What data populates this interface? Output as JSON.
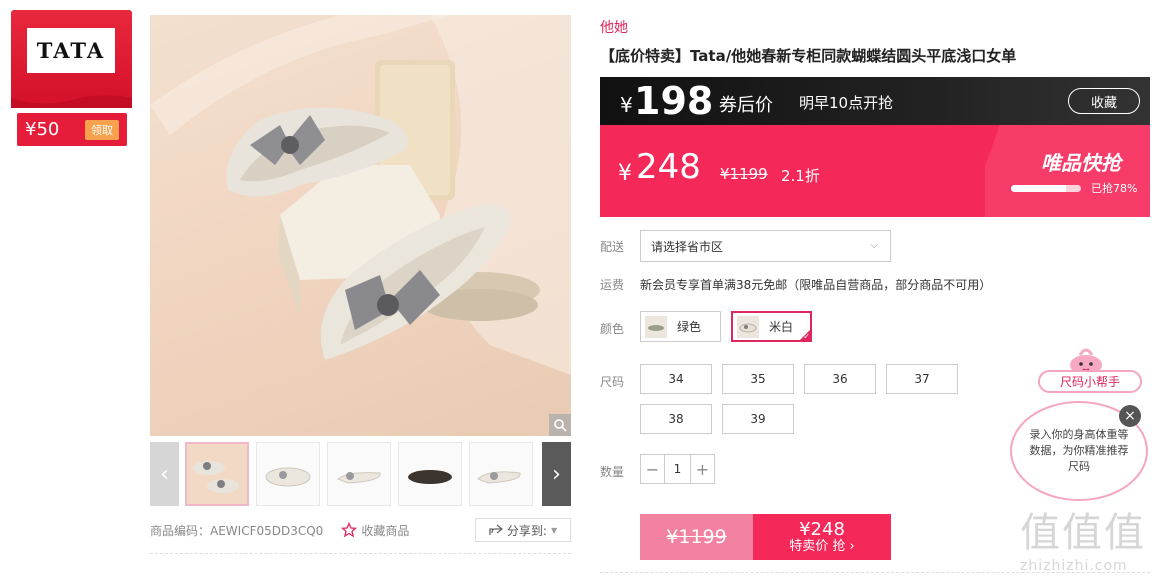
{
  "brand_badge": {
    "logo_text": "TATA",
    "coupon_value": "¥50",
    "coupon_action": "领取"
  },
  "gallery": {
    "thumbnails": [
      "thumb-1",
      "thumb-2",
      "thumb-3",
      "thumb-4",
      "thumb-5"
    ],
    "active_index": 0
  },
  "meta": {
    "sku_label": "商品编码：AEWICF05DD3CQ0",
    "favorite_label": "收藏商品",
    "share_label": "分享到:"
  },
  "product": {
    "brand": "他她",
    "title": "【底价特卖】Tata/他她春新专柜同款蝴蝶结圆头平底浅口女单"
  },
  "coupon_price": {
    "currency": "¥",
    "price": "198",
    "label": "券后价",
    "open_time": "明早10点开抢",
    "collect_label": "收藏"
  },
  "flash_price": {
    "currency": "¥",
    "price": "248",
    "original": "¥1199",
    "discount": "2.1折",
    "title": "唯品快抢",
    "sold_pct": 0.78,
    "sold_text": "已抢78%"
  },
  "attrs": {
    "delivery_label": "配送",
    "delivery_placeholder": "请选择省市区",
    "fee_label": "运费",
    "fee_text": "新会员专享首单满38元免邮（限唯品自营商品，部分商品不可用）",
    "color_label": "颜色",
    "colors": [
      "绿色",
      "米白"
    ],
    "selected_color": "米白",
    "size_label": "尺码",
    "sizes": [
      "34",
      "35",
      "36",
      "37",
      "38",
      "39"
    ],
    "qty_label": "数量",
    "qty_value": "1"
  },
  "buy": {
    "original": "¥1199",
    "price": "¥248",
    "action": "特卖价 抢 ›"
  },
  "size_helper": {
    "tag": "尺码小帮手",
    "message": "录入你的身高体重等数据，为你精准推荐尺码"
  },
  "watermark": {
    "text": "值值值",
    "url": "zhizhizhi.com"
  },
  "colors": {
    "brand_pink": "#f5285a",
    "accent": "#e0265e",
    "dark": "#1a1a1a"
  }
}
